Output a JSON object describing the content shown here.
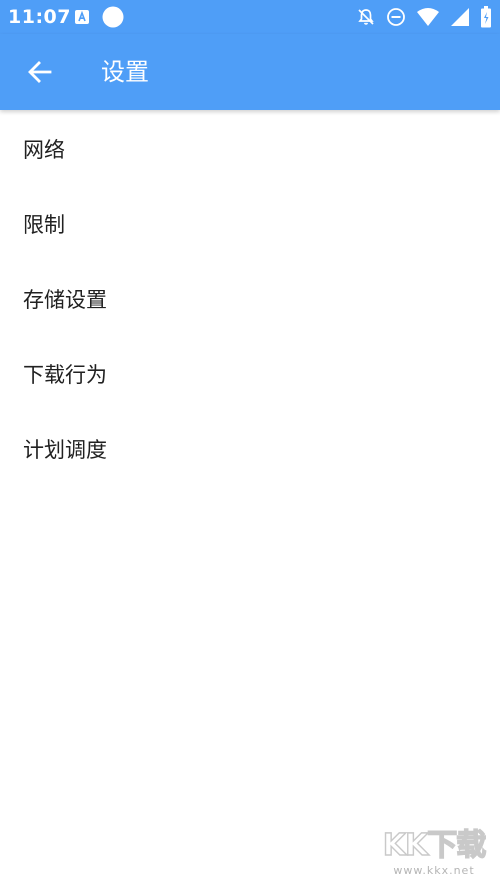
{
  "status_bar": {
    "time": "11:07",
    "icons": [
      "app-notification-icon",
      "circle-dot-icon",
      "notifications-off-icon",
      "do-not-disturb-icon",
      "wifi-icon",
      "signal-icon",
      "battery-icon"
    ]
  },
  "app_bar": {
    "back_icon": "arrow-left-icon",
    "title": "设置"
  },
  "settings": {
    "items": [
      {
        "label": "网络"
      },
      {
        "label": "限制"
      },
      {
        "label": "存储设置"
      },
      {
        "label": "下载行为"
      },
      {
        "label": "计划调度"
      }
    ]
  },
  "watermark": {
    "logo_text": "KK下载",
    "url": "www.kkx.net"
  },
  "colors": {
    "primary": "#4f9ef7",
    "text": "#212121",
    "background": "#ffffff"
  }
}
